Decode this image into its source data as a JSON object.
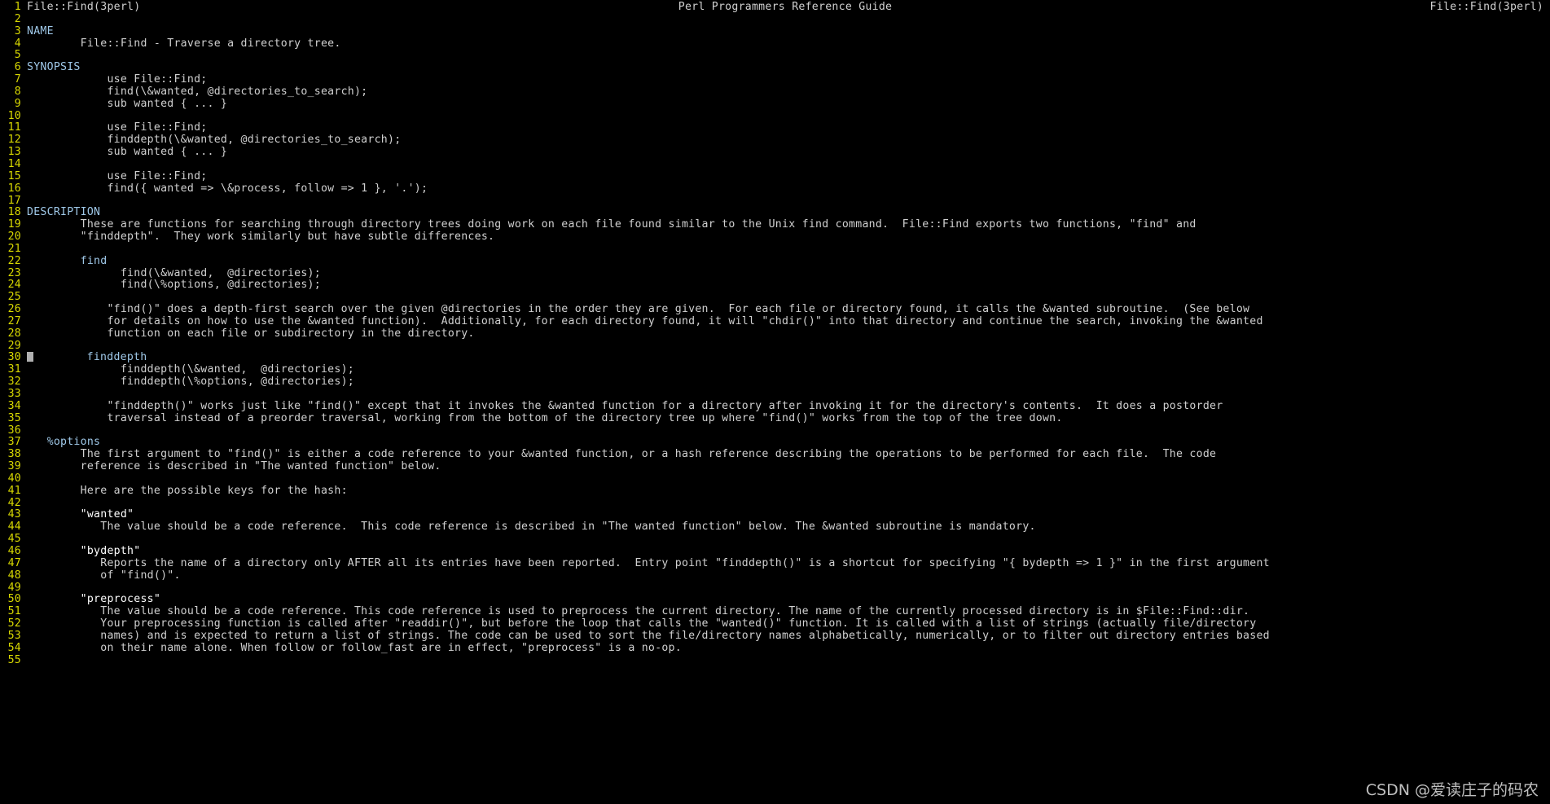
{
  "terminal": {
    "title_left": "File::Find(3perl)",
    "title_center": "Perl Programmers Reference Guide",
    "title_right": "File::Find(3perl)",
    "colors": {
      "background": "#000000",
      "line_number": "#d8d800",
      "body_text": "#d0d0d0",
      "section_heading": "#9fc8e8",
      "cursor": "#b0b0b0"
    },
    "cursor": {
      "line": 30,
      "visible": true
    },
    "watermark": "CSDN @爱读庄子的码农",
    "lines": [
      {
        "n": "1",
        "text": "",
        "style": "header"
      },
      {
        "n": "2",
        "text": "",
        "style": "normal"
      },
      {
        "n": "3",
        "text": "NAME",
        "style": "section"
      },
      {
        "n": "4",
        "text": "        File::Find - Traverse a directory tree.",
        "style": "normal"
      },
      {
        "n": "5",
        "text": "",
        "style": "normal"
      },
      {
        "n": "6",
        "text": "SYNOPSIS",
        "style": "section"
      },
      {
        "n": "7",
        "text": "            use File::Find;",
        "style": "normal"
      },
      {
        "n": "8",
        "text": "            find(\\&wanted, @directories_to_search);",
        "style": "normal"
      },
      {
        "n": "9",
        "text": "            sub wanted { ... }",
        "style": "normal"
      },
      {
        "n": "10",
        "text": "",
        "style": "normal"
      },
      {
        "n": "11",
        "text": "            use File::Find;",
        "style": "normal"
      },
      {
        "n": "12",
        "text": "            finddepth(\\&wanted, @directories_to_search);",
        "style": "normal"
      },
      {
        "n": "13",
        "text": "            sub wanted { ... }",
        "style": "normal"
      },
      {
        "n": "14",
        "text": "",
        "style": "normal"
      },
      {
        "n": "15",
        "text": "            use File::Find;",
        "style": "normal"
      },
      {
        "n": "16",
        "text": "            find({ wanted => \\&process, follow => 1 }, '.');",
        "style": "normal"
      },
      {
        "n": "17",
        "text": "",
        "style": "normal"
      },
      {
        "n": "18",
        "text": "DESCRIPTION",
        "style": "section"
      },
      {
        "n": "19",
        "text": "        These are functions for searching through directory trees doing work on each file found similar to the Unix find command.  File::Find exports two functions, \"find\" and",
        "style": "normal"
      },
      {
        "n": "20",
        "text": "        \"finddepth\".  They work similarly but have subtle differences.",
        "style": "normal"
      },
      {
        "n": "21",
        "text": "",
        "style": "normal"
      },
      {
        "n": "22",
        "text": "        find",
        "style": "section"
      },
      {
        "n": "23",
        "text": "              find(\\&wanted,  @directories);",
        "style": "normal"
      },
      {
        "n": "24",
        "text": "              find(\\%options, @directories);",
        "style": "normal"
      },
      {
        "n": "25",
        "text": "",
        "style": "normal"
      },
      {
        "n": "26",
        "text": "            \"find()\" does a depth-first search over the given @directories in the order they are given.  For each file or directory found, it calls the &wanted subroutine.  (See below",
        "style": "normal"
      },
      {
        "n": "27",
        "text": "            for details on how to use the &wanted function).  Additionally, for each directory found, it will \"chdir()\" into that directory and continue the search, invoking the &wanted",
        "style": "normal"
      },
      {
        "n": "28",
        "text": "            function on each file or subdirectory in the directory.",
        "style": "normal"
      },
      {
        "n": "29",
        "text": "",
        "style": "normal"
      },
      {
        "n": "30",
        "text": "        finddepth",
        "style": "section",
        "cursor": true
      },
      {
        "n": "31",
        "text": "              finddepth(\\&wanted,  @directories);",
        "style": "normal"
      },
      {
        "n": "32",
        "text": "              finddepth(\\%options, @directories);",
        "style": "normal"
      },
      {
        "n": "33",
        "text": "",
        "style": "normal"
      },
      {
        "n": "34",
        "text": "            \"finddepth()\" works just like \"find()\" except that it invokes the &wanted function for a directory after invoking it for the directory's contents.  It does a postorder",
        "style": "normal"
      },
      {
        "n": "35",
        "text": "            traversal instead of a preorder traversal, working from the bottom of the directory tree up where \"find()\" works from the top of the tree down.",
        "style": "normal"
      },
      {
        "n": "36",
        "text": "",
        "style": "normal"
      },
      {
        "n": "37",
        "text": "   %options",
        "style": "section"
      },
      {
        "n": "38",
        "text": "        The first argument to \"find()\" is either a code reference to your &wanted function, or a hash reference describing the operations to be performed for each file.  The code",
        "style": "normal"
      },
      {
        "n": "39",
        "text": "        reference is described in \"The wanted function\" below.",
        "style": "normal"
      },
      {
        "n": "40",
        "text": "",
        "style": "normal"
      },
      {
        "n": "41",
        "text": "        Here are the possible keys for the hash:",
        "style": "normal"
      },
      {
        "n": "42",
        "text": "",
        "style": "normal"
      },
      {
        "n": "43",
        "text": "        \"wanted\"",
        "style": "bold"
      },
      {
        "n": "44",
        "text": "           The value should be a code reference.  This code reference is described in \"The wanted function\" below. The &wanted subroutine is mandatory.",
        "style": "normal"
      },
      {
        "n": "45",
        "text": "",
        "style": "normal"
      },
      {
        "n": "46",
        "text": "        \"bydepth\"",
        "style": "bold"
      },
      {
        "n": "47",
        "text": "           Reports the name of a directory only AFTER all its entries have been reported.  Entry point \"finddepth()\" is a shortcut for specifying \"{ bydepth => 1 }\" in the first argument",
        "style": "normal"
      },
      {
        "n": "48",
        "text": "           of \"find()\".",
        "style": "normal"
      },
      {
        "n": "49",
        "text": "",
        "style": "normal"
      },
      {
        "n": "50",
        "text": "        \"preprocess\"",
        "style": "bold"
      },
      {
        "n": "51",
        "text": "           The value should be a code reference. This code reference is used to preprocess the current directory. The name of the currently processed directory is in $File::Find::dir.",
        "style": "normal"
      },
      {
        "n": "52",
        "text": "           Your preprocessing function is called after \"readdir()\", but before the loop that calls the \"wanted()\" function. It is called with a list of strings (actually file/directory",
        "style": "normal"
      },
      {
        "n": "53",
        "text": "           names) and is expected to return a list of strings. The code can be used to sort the file/directory names alphabetically, numerically, or to filter out directory entries based",
        "style": "normal"
      },
      {
        "n": "54",
        "text": "           on their name alone. When follow or follow_fast are in effect, \"preprocess\" is a no-op.",
        "style": "normal"
      },
      {
        "n": "55",
        "text": "",
        "style": "normal"
      }
    ]
  }
}
